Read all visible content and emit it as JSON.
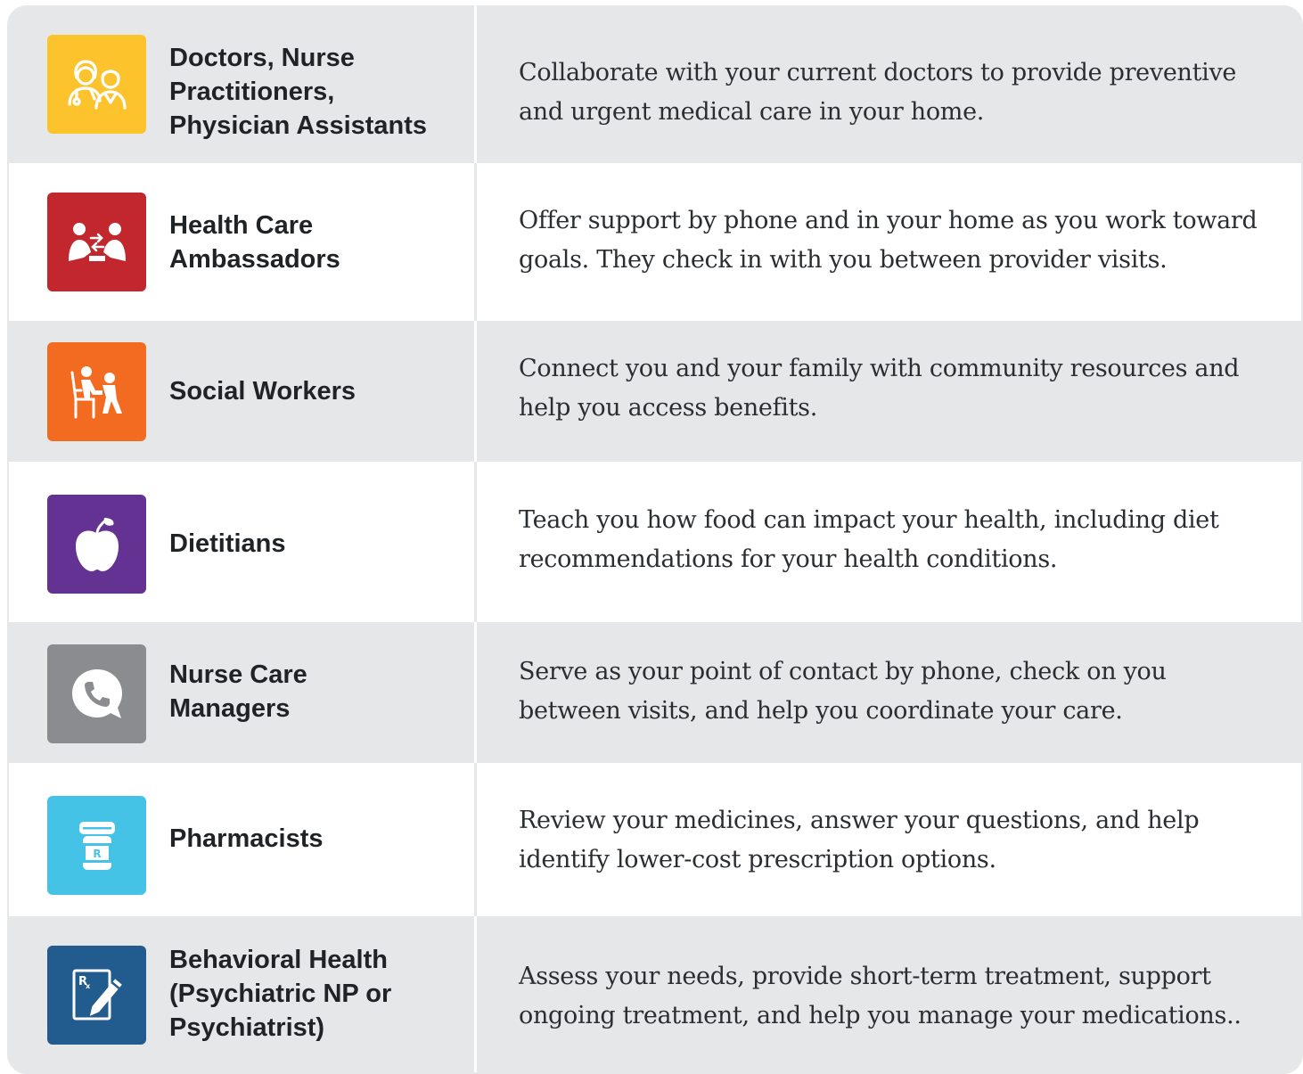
{
  "rows": [
    {
      "role": [
        "Doctors, Nurse",
        "Practitioners,",
        "Physician Assistants"
      ],
      "description": [
        "Collaborate with your current doctors to provide preventive",
        "and urgent medical care in your home."
      ],
      "icon": "doctors-icon",
      "color": "#fcc32d"
    },
    {
      "role": [
        "Health Care",
        "Ambassadors"
      ],
      "description": [
        "Offer support by phone and in your home as you work toward",
        "goals. They check in with you between provider visits."
      ],
      "icon": "ambassadors-icon",
      "color": "#c1272d"
    },
    {
      "role": [
        "Social Workers"
      ],
      "description": [
        "Connect you and your family with community resources and",
        "help you access benefits."
      ],
      "icon": "social-workers-icon",
      "color": "#f26b21"
    },
    {
      "role": [
        "Dietitians"
      ],
      "description": [
        "Teach you how food can impact your health, including diet",
        "recommendations for your health conditions."
      ],
      "icon": "apple-icon",
      "color": "#633293"
    },
    {
      "role": [
        "Nurse Care",
        "Managers"
      ],
      "description": [
        "Serve as your point of contact by phone, check on you",
        "between visits, and help you coordinate your care."
      ],
      "icon": "phone-bubble-icon",
      "color": "#8a8c8f"
    },
    {
      "role": [
        "Pharmacists"
      ],
      "description": [
        "Review your medicines, answer your questions, and help",
        "identify lower-cost prescription options."
      ],
      "icon": "pill-bottle-icon",
      "color": "#45c3e6"
    },
    {
      "role": [
        "Behavioral Health",
        "(Psychiatric NP or",
        "Psychiatrist)"
      ],
      "description": [
        "Assess your needs, provide short-term treatment, support",
        "ongoing treatment, and help you manage your medications.."
      ],
      "icon": "prescription-pad-icon",
      "color": "#225b8e"
    }
  ]
}
